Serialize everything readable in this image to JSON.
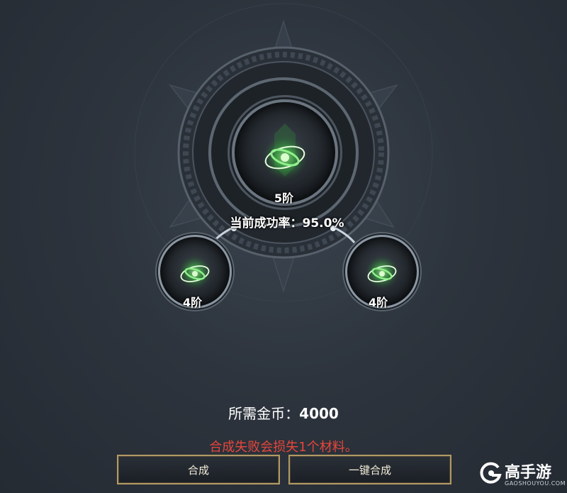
{
  "synthesis": {
    "result_tier": "5阶",
    "success_rate_label": "当前成功率：",
    "success_rate_value": "95.0%",
    "material_left_tier": "4阶",
    "material_right_tier": "4阶",
    "gem_icon": "green-vortex-icon"
  },
  "cost": {
    "label": "所需金币：",
    "value": "4000"
  },
  "warning": "合成失败会损失1个材料。",
  "buttons": {
    "compose": "合成",
    "compose_all": "一键合成"
  },
  "watermark": {
    "brand": "高手游",
    "domain": "GAOSHOUYOU.COM"
  },
  "colors": {
    "warning": "#e8453c",
    "button_border": "#b29a64",
    "gem_glow": "#5fe05a"
  }
}
